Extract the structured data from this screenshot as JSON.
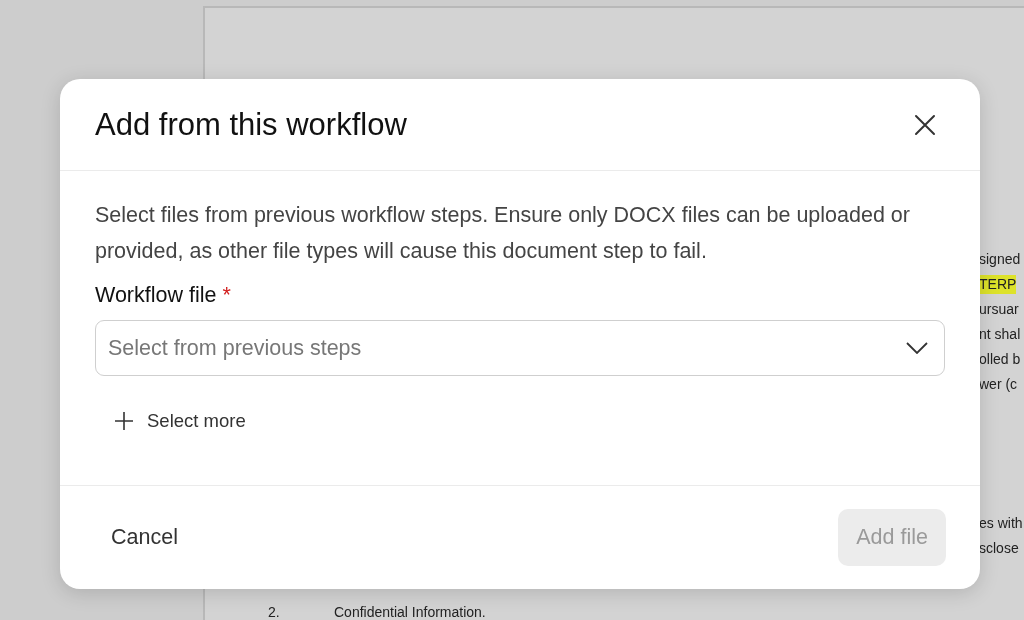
{
  "document": {
    "blocks": [
      {
        "lines": [
          {
            "text": "signed",
            "highlighted": false
          },
          {
            "text": "TERP",
            "highlighted": true
          },
          {
            "text": "ursuar",
            "highlighted": false
          },
          {
            "text": "nt shal",
            "highlighted": false
          },
          {
            "text": "olled b",
            "highlighted": false
          },
          {
            "text": "wer (c",
            "highlighted": false
          }
        ]
      },
      {
        "lines": [
          {
            "text": "es with",
            "highlighted": false
          },
          {
            "text": "sclose",
            "highlighted": false
          }
        ]
      }
    ],
    "section": {
      "number": "2.",
      "heading": "Confidential Information."
    }
  },
  "dialog": {
    "title": "Add from this workflow",
    "description": "Select files from previous workflow steps. Ensure only DOCX files can be uploaded or provided, as other file types will cause this document step to fail.",
    "field": {
      "label": "Workflow file",
      "required": true,
      "required_marker": "*",
      "placeholder": "Select from previous steps"
    },
    "select_more": "Select more",
    "buttons": [
      {
        "label": "Cancel",
        "kind": "text",
        "disabled": false
      },
      {
        "label": "Add file",
        "kind": "primary",
        "disabled": true
      }
    ]
  }
}
